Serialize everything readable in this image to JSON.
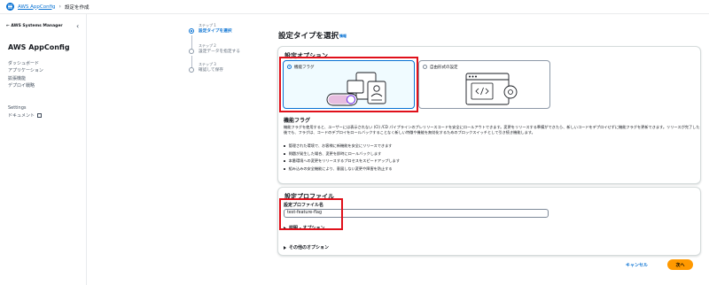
{
  "breadcrumb": {
    "service": "AWS AppConfig",
    "current": "設定を作成"
  },
  "sidebar": {
    "parent": "AWS Systems Manager",
    "title": "AWS AppConfig",
    "nav": [
      "ダッシュボード",
      "アプリケーション",
      "拡張機能",
      "デプロイ戦略"
    ],
    "nav2": [
      "Settings",
      "ドキュメント"
    ]
  },
  "steps": [
    {
      "number": "ステップ 1",
      "name": "設定タイプを選択"
    },
    {
      "number": "ステップ 2",
      "name": "設定データを指定する"
    },
    {
      "number": "ステップ 3",
      "name": "確認して保存"
    }
  ],
  "main": {
    "title": "設定タイプを選択",
    "info": "情報",
    "options_heading": "設定オプション",
    "option_feature_flag": "機能フラグ",
    "option_freeform": "自由形式の設定",
    "feature_heading": "機能フラグ",
    "feature_desc": "機能フラグを使用すると、ユーザーには表示されない (CI) /CD パイプラインのプレリリースコードを安全にロールアウトできます。変更をリリースする準備ができたら、新しいコードをデプロイせずに機能フラグを更新できます。リリースが完了した後でも、フラグは、コードのデプロイをロールバックすることなく新しい特徴や機能を無効化するためのブロックスイッチとして引き続き機能します。",
    "feature_bullets": [
      "管理された環境で、お客様に新機能を安全にリリースできます",
      "問題が発生した場合、変更を即時にロールバックします",
      "本番環境への変更をリリースするプロセスをスピードアップします",
      "組み込みの安全機能により、意図しない変更や障害を防止する"
    ],
    "profile_heading": "設定プロファイル",
    "profile_name_label": "設定プロファイル名",
    "profile_name_value": "test-feature-flag",
    "description_expander": "説明 - オプション",
    "other_options": "その他のオプション"
  },
  "footer": {
    "cancel": "キャンセル",
    "next": "次へ"
  },
  "colors": {
    "accent": "#0972d3",
    "primary_button": "#ff9900",
    "highlight": "#e0101a"
  }
}
